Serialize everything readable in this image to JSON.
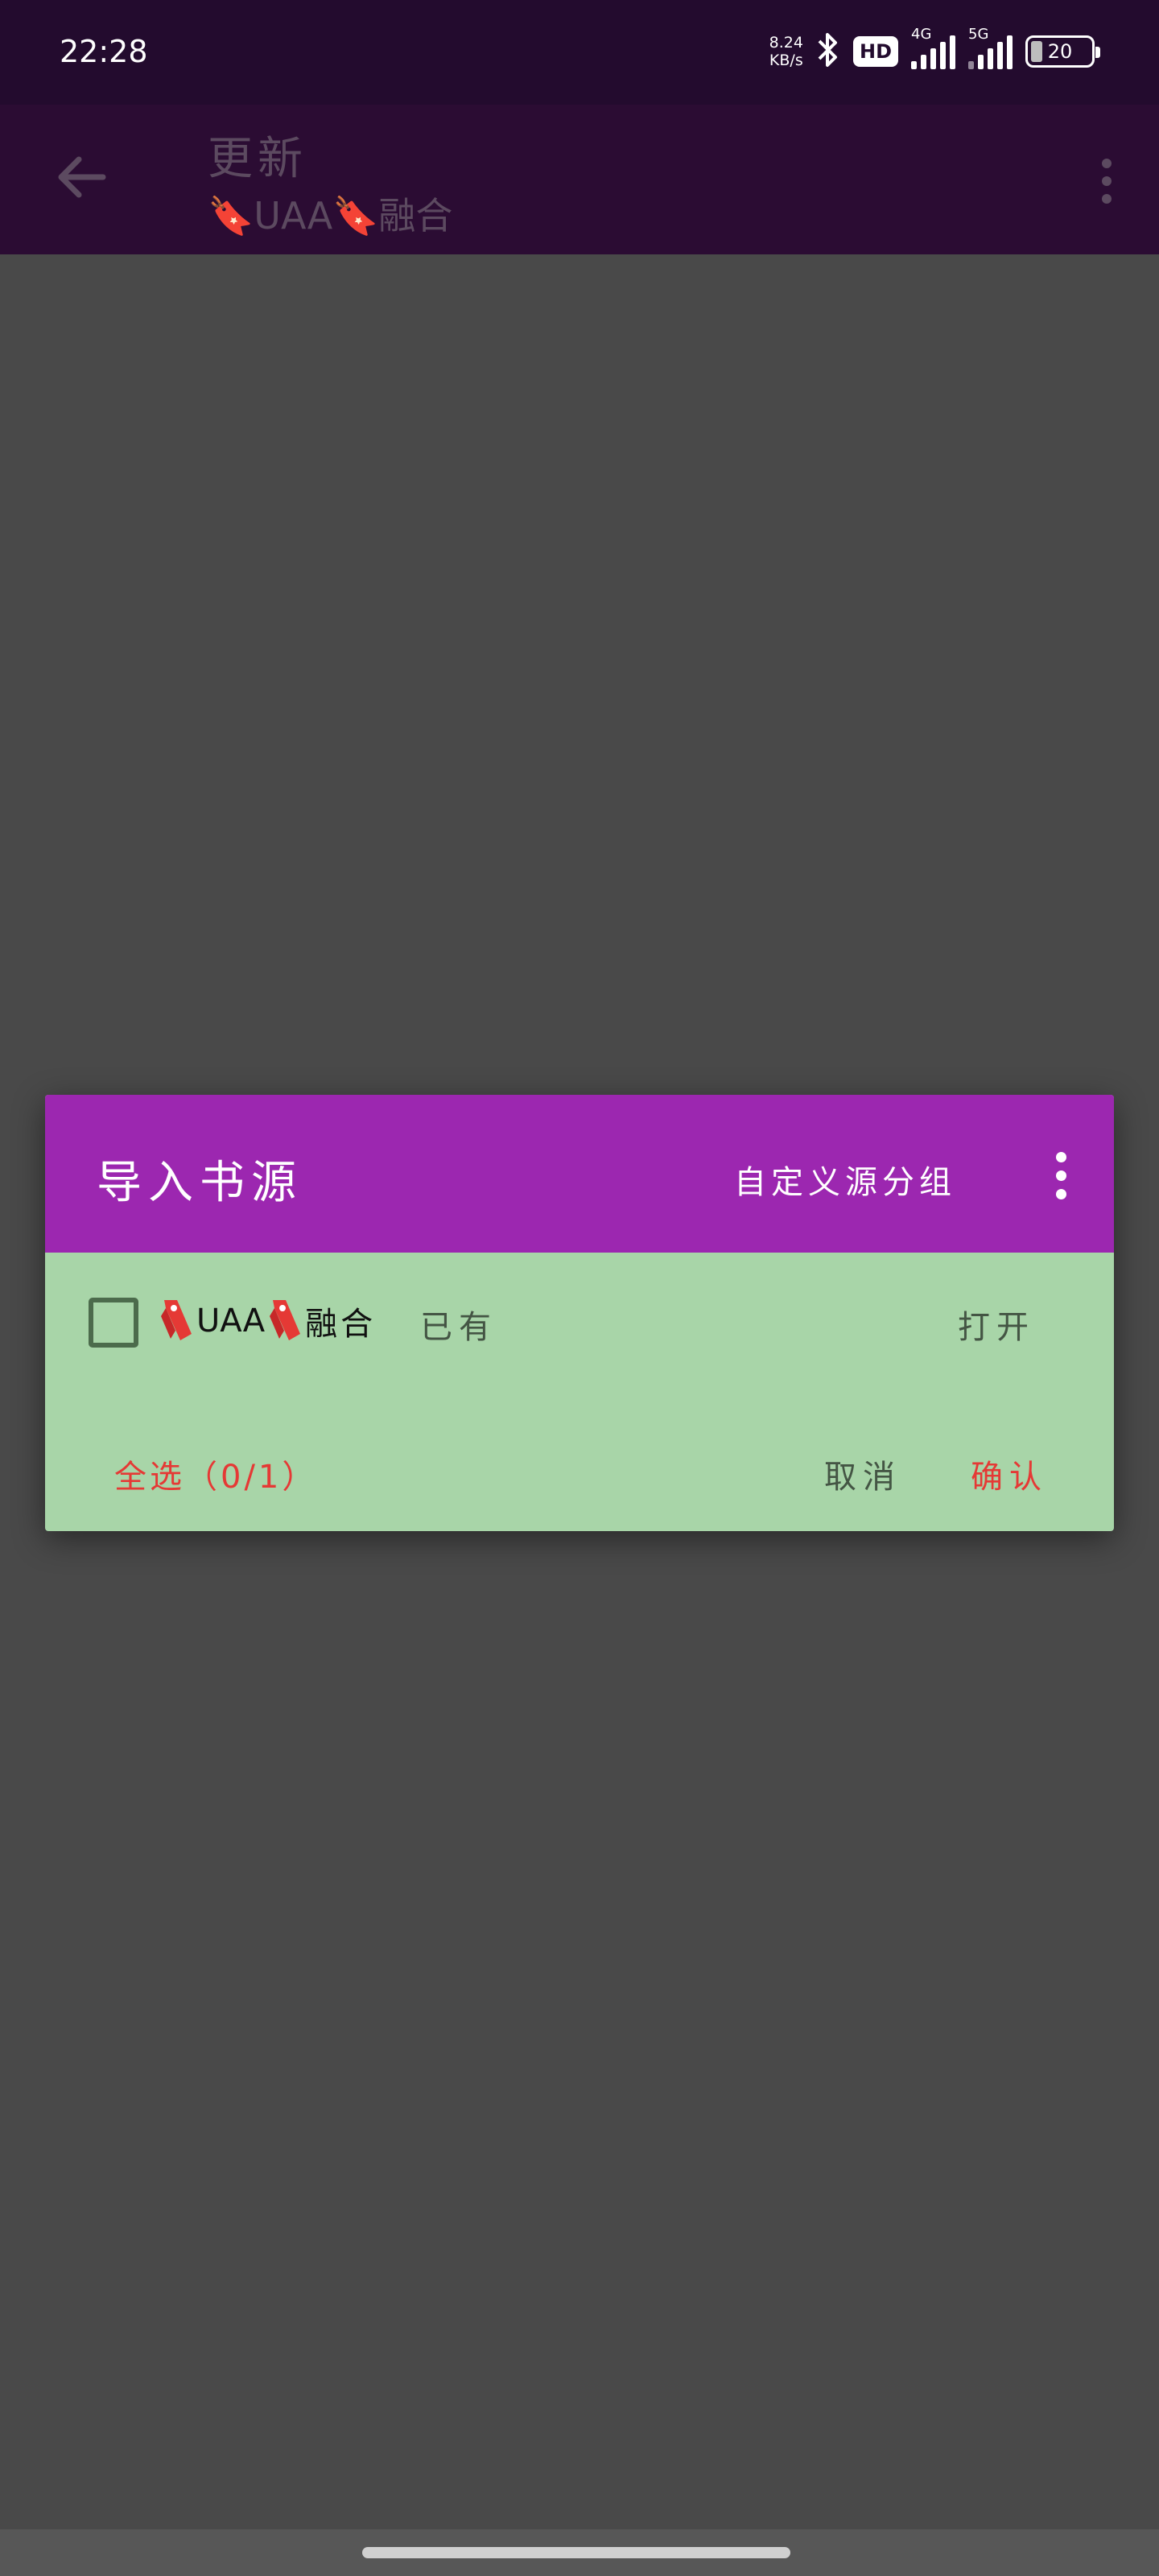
{
  "status_bar": {
    "time": "22:28",
    "net_speed_value": "8.24",
    "net_speed_unit": "KB/s",
    "hd_badge": "HD",
    "signal1_gen": "4G",
    "signal2_gen": "5G",
    "battery": "20",
    "icons": [
      "bluetooth-icon",
      "signal-icon",
      "battery-icon"
    ]
  },
  "app_bar": {
    "title": "更新",
    "subtitle": "🔖UAA🔖融合",
    "icons": [
      "back-arrow-icon",
      "more-vert-icon"
    ]
  },
  "dialog": {
    "title": "导入书源",
    "group_button": "自定义源分组",
    "item": {
      "name": "UAA",
      "name_suffix": "融合",
      "status": "已有",
      "open_label": "打开",
      "checked": false
    },
    "footer": {
      "select_all": "全选（0/1）",
      "cancel": "取消",
      "confirm": "确认"
    }
  },
  "colors": {
    "status_bar_bg": "#230b2e",
    "dialog_header": "#9c27b0",
    "dialog_body": "#a8d5a8",
    "accent_red": "#e53935",
    "scrim": "#494949"
  }
}
